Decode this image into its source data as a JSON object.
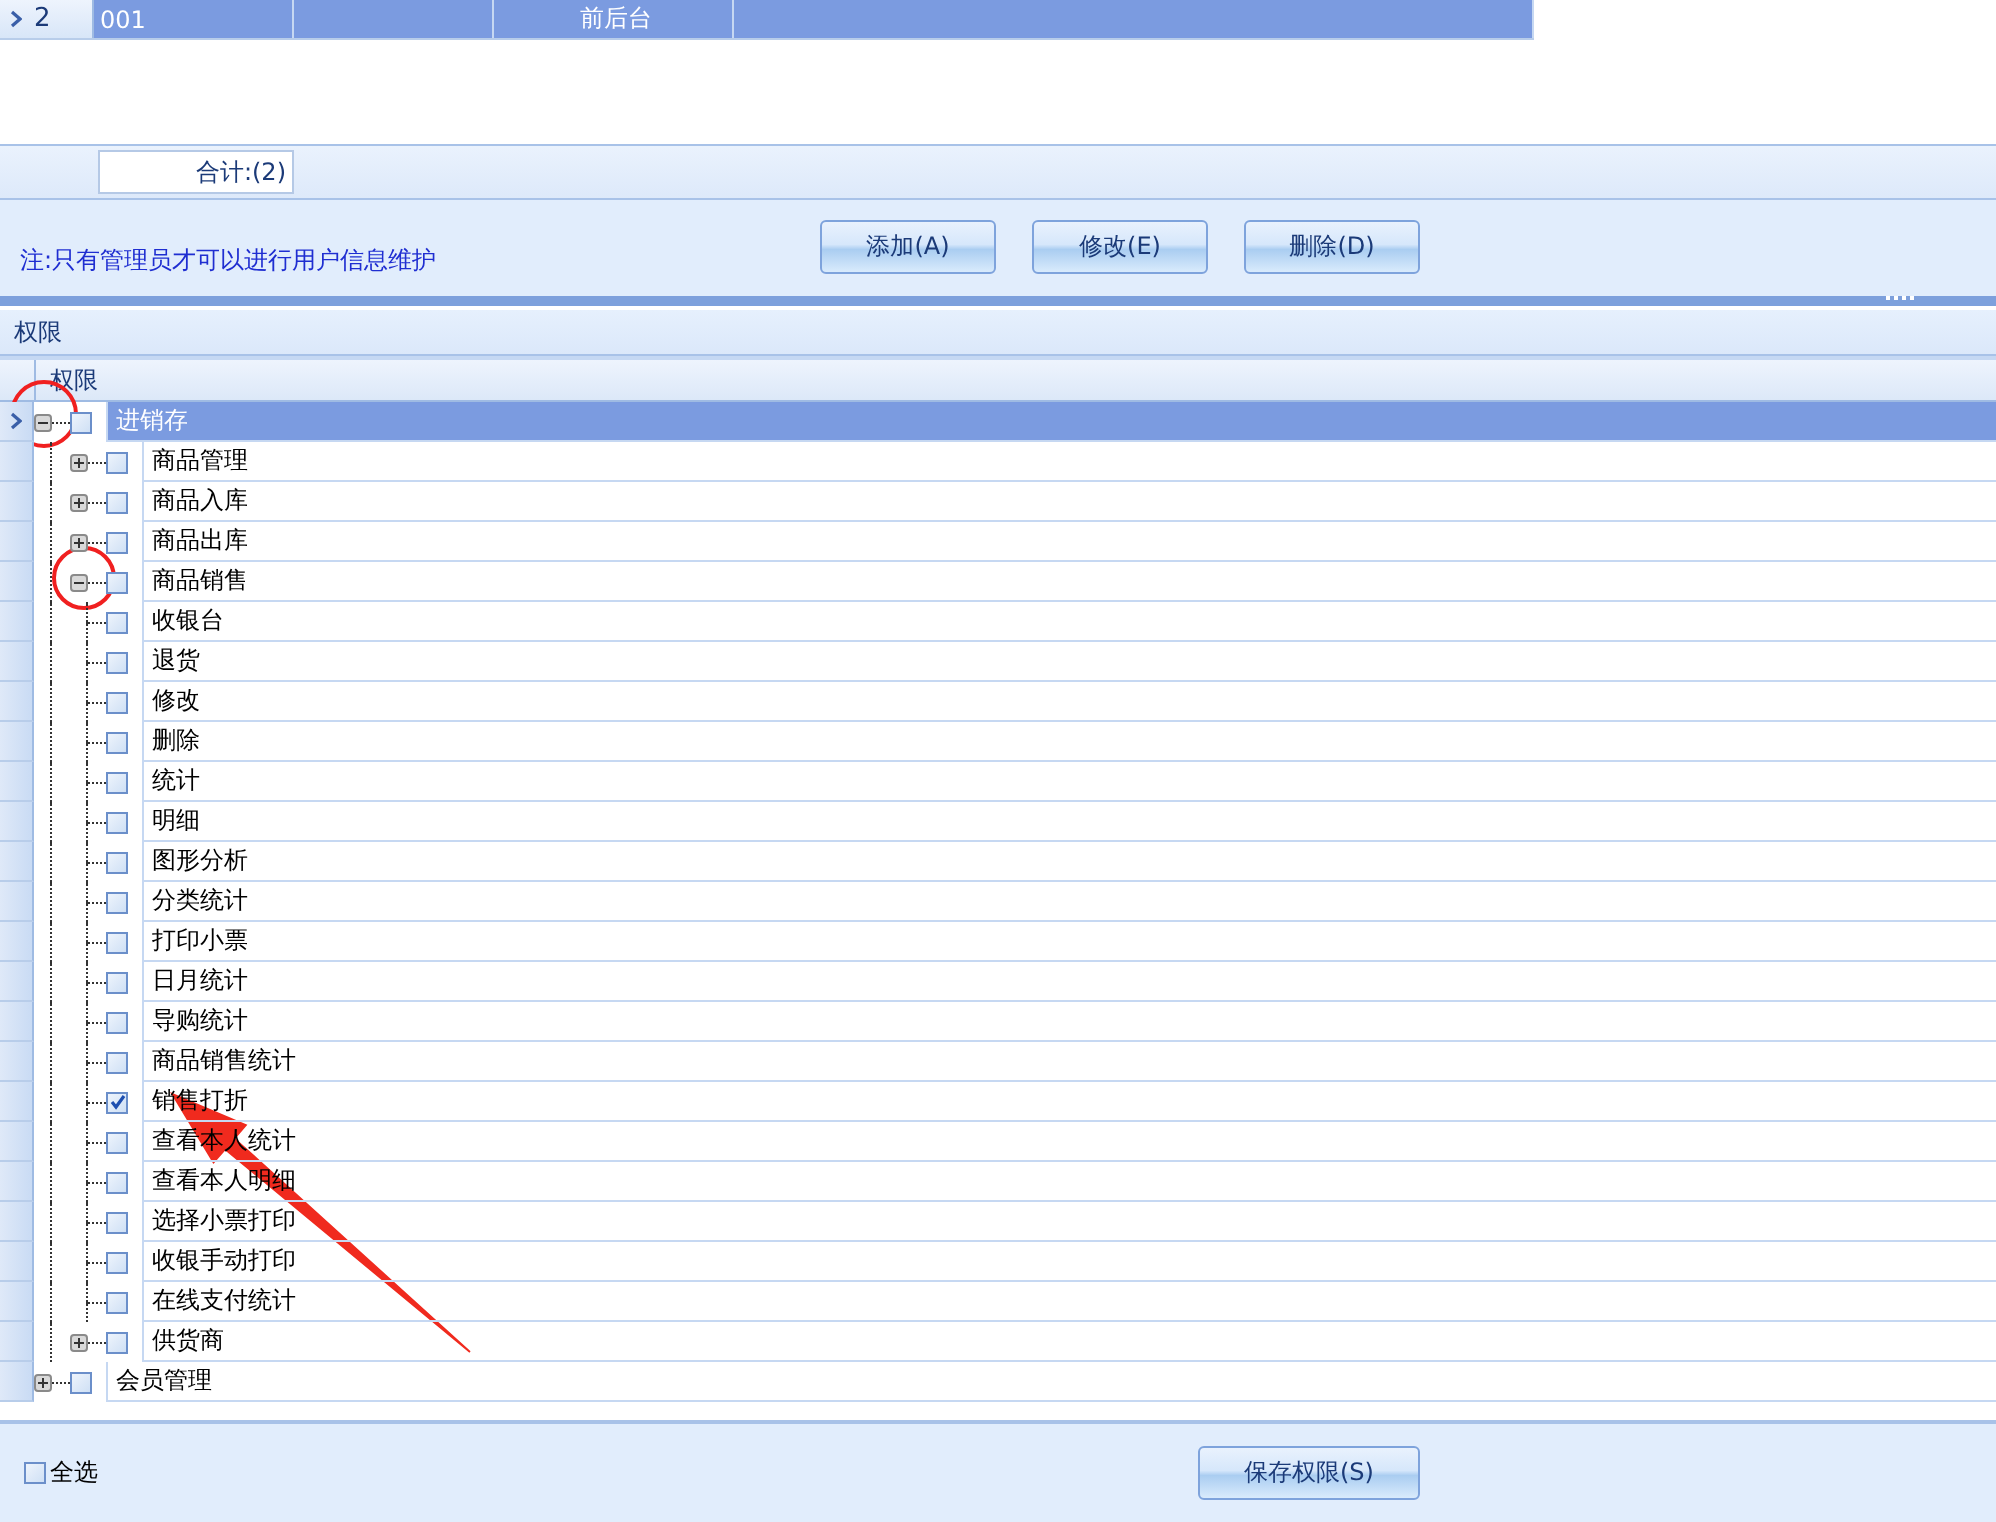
{
  "user_grid": {
    "rows": [
      {
        "number": "2",
        "code": "001",
        "role": "前后台",
        "selected": true
      }
    ]
  },
  "summary": {
    "total": "合计:(2)"
  },
  "note": "注:只有管理员才可以进行用户信息维护",
  "buttons": [
    {
      "label": "添加(A)"
    },
    {
      "label": "修改(E)"
    },
    {
      "label": "删除(D)"
    }
  ],
  "panel_title": "权限",
  "tree": {
    "column": "权限",
    "nodes": [
      {
        "label": "进销存",
        "checked": false,
        "expanded": true,
        "selected": true,
        "children": [
          {
            "label": "商品管理",
            "checked": false,
            "expanded": false,
            "selected": false
          },
          {
            "label": "商品入库",
            "checked": false,
            "expanded": false,
            "selected": false
          },
          {
            "label": "商品出库",
            "checked": false,
            "expanded": false,
            "selected": false
          },
          {
            "label": "商品销售",
            "checked": false,
            "expanded": true,
            "selected": false,
            "children": [
              {
                "label": "收银台",
                "checked": false,
                "selected": false
              },
              {
                "label": "退货",
                "checked": false,
                "selected": false
              },
              {
                "label": "修改",
                "checked": false,
                "selected": false
              },
              {
                "label": "删除",
                "checked": false,
                "selected": false
              },
              {
                "label": "统计",
                "checked": false,
                "selected": false
              },
              {
                "label": "明细",
                "checked": false,
                "selected": false
              },
              {
                "label": "图形分析",
                "checked": false,
                "selected": false
              },
              {
                "label": "分类统计",
                "checked": false,
                "selected": false
              },
              {
                "label": "打印小票",
                "checked": false,
                "selected": false
              },
              {
                "label": "日月统计",
                "checked": false,
                "selected": false
              },
              {
                "label": "导购统计",
                "checked": false,
                "selected": false
              },
              {
                "label": "商品销售统计",
                "checked": false,
                "selected": false
              },
              {
                "label": "销售打折",
                "checked": true,
                "selected": false
              },
              {
                "label": "查看本人统计",
                "checked": false,
                "selected": false
              },
              {
                "label": "查看本人明细",
                "checked": false,
                "selected": false
              },
              {
                "label": "选择小票打印",
                "checked": false,
                "selected": false
              },
              {
                "label": "收银手动打印",
                "checked": false,
                "selected": false
              },
              {
                "label": "在线支付统计",
                "checked": false,
                "selected": false
              }
            ]
          },
          {
            "label": "供货商",
            "checked": false,
            "expanded": false,
            "selected": false
          }
        ]
      },
      {
        "label": "会员管理",
        "checked": false,
        "expanded": false,
        "selected": false
      }
    ]
  },
  "select_all": {
    "label": "全选",
    "checked": false
  },
  "save_button": "保存权限(S)"
}
